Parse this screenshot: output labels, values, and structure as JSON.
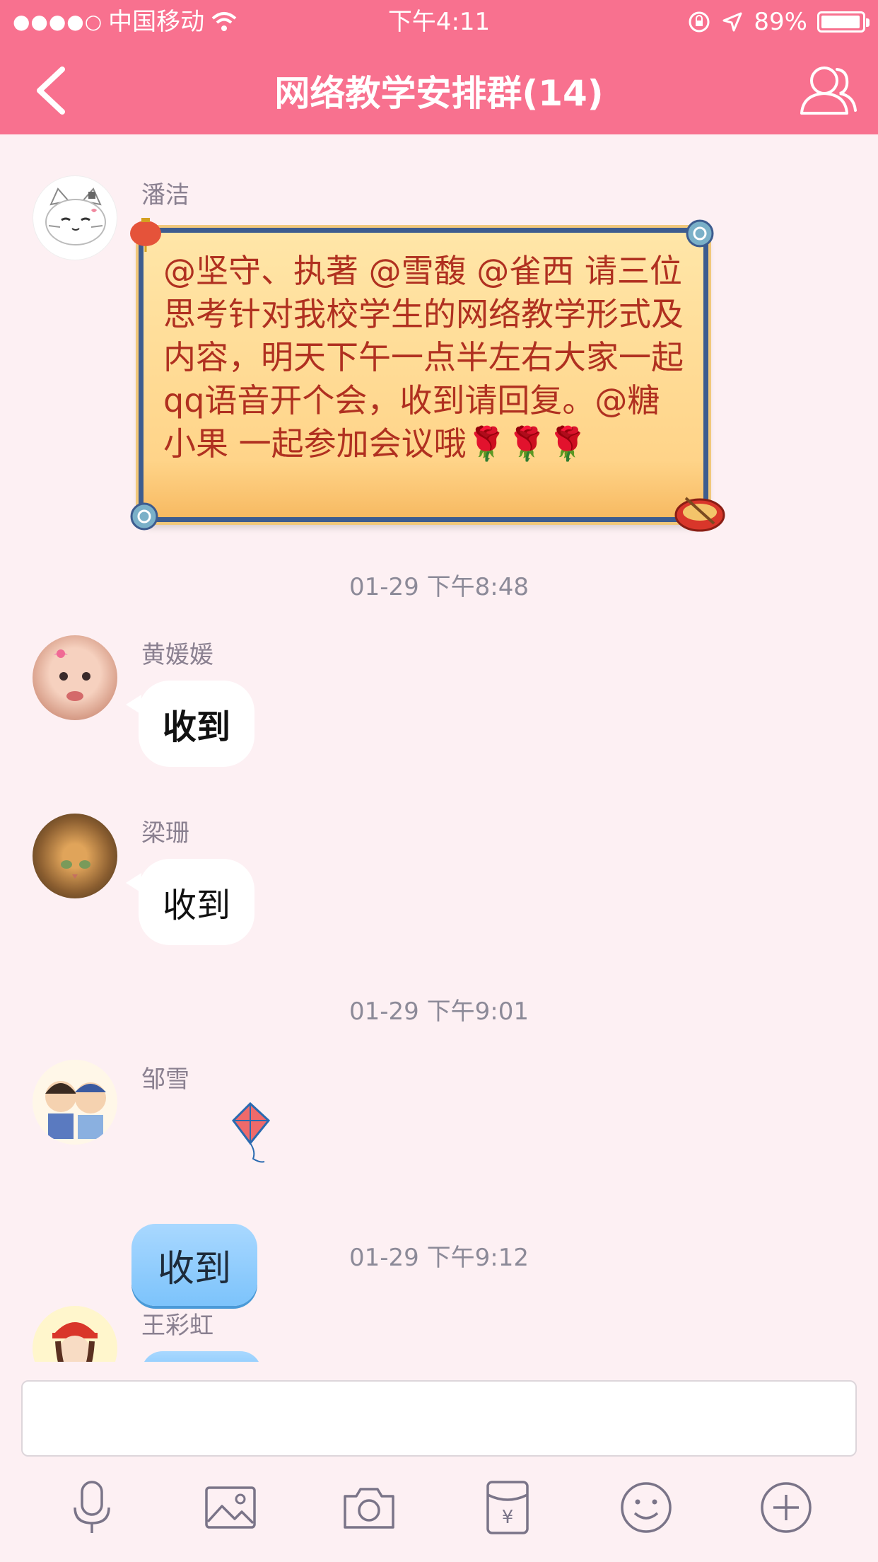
{
  "status_bar": {
    "signal": "●●●●○",
    "carrier": "中国移动",
    "time": "下午4:11",
    "battery": "89%",
    "battery_level": 0.89
  },
  "nav": {
    "title": "网络教学安排群(14)"
  },
  "messages": [
    {
      "sender": "潘洁",
      "text": "@坚守、执著 @雪馥 @雀西 请三位思考针对我校学生的网络教学形式及内容，明天下午一点半左右大家一起qq语音开个会，收到请回复。@糖小果 一起参加会议哦🌹🌹🌹"
    },
    {
      "timestamp": "01-29 下午8:48"
    },
    {
      "sender": "黄媛媛",
      "text": "收到"
    },
    {
      "sender": "梁珊",
      "text": "收到"
    },
    {
      "timestamp": "01-29 下午9:01"
    },
    {
      "sender": "邹雪",
      "text": "收到"
    },
    {
      "timestamp": "01-29 下午9:12"
    },
    {
      "sender": "王彩虹"
    }
  ],
  "toolbar": {
    "icons": [
      "microphone-icon",
      "image-icon",
      "camera-icon",
      "red-packet-icon",
      "emoji-icon",
      "plus-icon"
    ]
  },
  "colors": {
    "header": "#f8718f",
    "background": "#fdf0f3"
  }
}
